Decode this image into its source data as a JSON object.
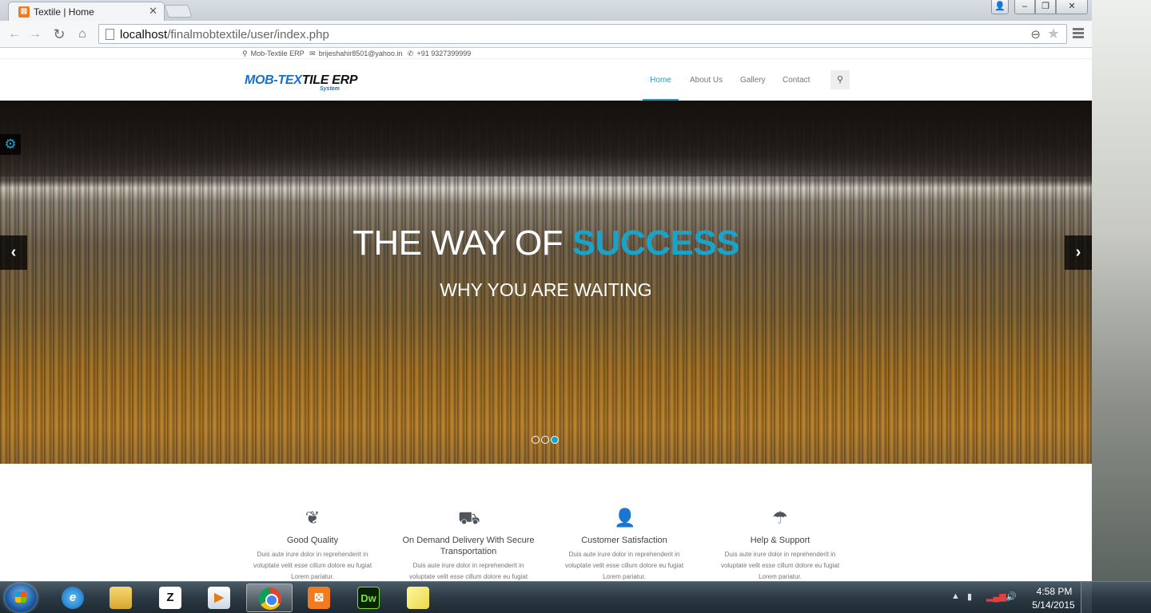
{
  "browser": {
    "tab_title": "Textile | Home",
    "tab_favicon": "xampp-icon",
    "url_host": "localhost",
    "url_path": "/finalmobtextile/user/index.php"
  },
  "topbar": {
    "company": "Mob-Textile ERP",
    "email": "brijeshahir8501@yahoo.in",
    "phone": "+91 9327399999"
  },
  "header": {
    "logo_part1": "MOB-TEX",
    "logo_part2": "TILE ERP",
    "logo_sub": "System",
    "nav": [
      "Home",
      "About Us",
      "Gallery",
      "Contact"
    ],
    "active_nav": "Home"
  },
  "hero": {
    "title_prefix": "THE WAY OF ",
    "title_accent": "SUCCESS",
    "subtitle": "WHY YOU ARE WAITING",
    "slides": 3,
    "active_slide": 3,
    "accent_color": "#1aa3c8"
  },
  "features": [
    {
      "icon": "leaf-icon",
      "title": "Good Quality",
      "text": "Duis aute irure dolor in reprehenderit in voluptate velit esse cillum dolore eu fugiat Lorem pariatur."
    },
    {
      "icon": "truck-icon",
      "title": "On Demand Delivery With Secure Transportation",
      "text": "Duis aute irure dolor in reprehenderit in voluptate velit esse cillum dolore eu fugiat Lorem pariatur."
    },
    {
      "icon": "user-icon",
      "title": "Customer Satisfaction",
      "text": "Duis aute irure dolor in reprehenderit in voluptate velit esse cillum dolore eu fugiat Lorem pariatur."
    },
    {
      "icon": "umbrella-icon",
      "title": "Help & Support",
      "text": "Duis aute irure dolor in reprehenderit in voluptate velit esse cillum dolore eu fugiat Lorem pariatur."
    }
  ],
  "taskbar": {
    "apps": [
      "internet-explorer",
      "file-explorer",
      "z-app",
      "media-player",
      "google-chrome",
      "xampp",
      "dreamweaver",
      "sticky-notes"
    ],
    "active_app": "google-chrome",
    "time": "4:58 PM",
    "date": "5/14/2015"
  }
}
